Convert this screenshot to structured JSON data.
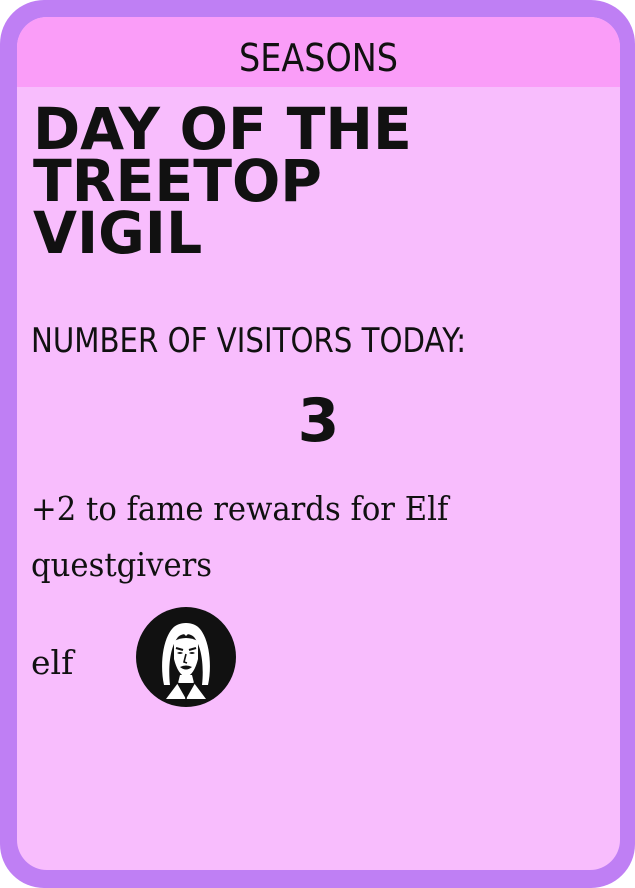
{
  "header": {
    "title": "SEASONS"
  },
  "card": {
    "title": "DAY OF THE\nTREETOP\nVIGIL",
    "visitors_label": "NUMBER OF VISITORS TODAY:",
    "visitors_count": "3",
    "effect_text": "+2 to fame rewards for Elf questgivers",
    "tag_label": "elf",
    "tag_icon": "elf-face-icon"
  },
  "colors": {
    "outer_border": "#bf7ff4",
    "card_background": "#f8bdfd",
    "header_background": "#fa9df8",
    "text": "#111111"
  }
}
